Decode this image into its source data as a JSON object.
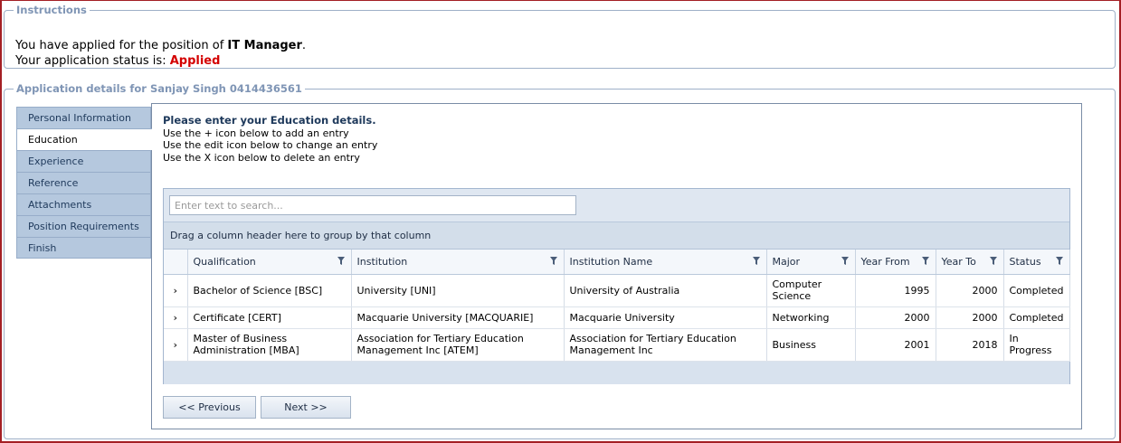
{
  "instructions": {
    "legend": "Instructions",
    "line1_prefix": "You have applied for the position of ",
    "position": "IT Manager",
    "line1_suffix": ".",
    "line2_prefix": "Your application status is: ",
    "status": "Applied"
  },
  "application": {
    "legend": "Application details for Sanjay Singh 0414436561"
  },
  "tabs": [
    {
      "label": "Personal Information",
      "active": false
    },
    {
      "label": "Education",
      "active": true
    },
    {
      "label": "Experience",
      "active": false
    },
    {
      "label": "Reference",
      "active": false
    },
    {
      "label": "Attachments",
      "active": false
    },
    {
      "label": "Position Requirements",
      "active": false
    },
    {
      "label": "Finish",
      "active": false
    }
  ],
  "education": {
    "title": "Please enter your Education details.",
    "hint_add": "Use the + icon below to add an entry",
    "hint_edit": "Use the edit icon below to change an entry",
    "hint_delete": "Use the X icon below to delete an entry"
  },
  "grid": {
    "search_placeholder": "Enter text to search...",
    "group_panel": "Drag a column header here to group by that column",
    "columns": [
      "Qualification",
      "Institution",
      "Institution Name",
      "Major",
      "Year From",
      "Year To",
      "Status"
    ],
    "rows": [
      {
        "qualification": "Bachelor of Science [BSC]",
        "institution": "University [UNI]",
        "institution_name": "University of Australia",
        "major": "Computer Science",
        "year_from": "1995",
        "year_to": "2000",
        "status": "Completed"
      },
      {
        "qualification": "Certificate [CERT]",
        "institution": "Macquarie University [MACQUARIE]",
        "institution_name": "Macquarie University",
        "major": "Networking",
        "year_from": "2000",
        "year_to": "2000",
        "status": "Completed"
      },
      {
        "qualification": "Master of Business Administration [MBA]",
        "institution": "Association for Tertiary Education Management Inc [ATEM]",
        "institution_name": "Association for Tertiary Education Management Inc",
        "major": "Business",
        "year_from": "2001",
        "year_to": "2018",
        "status": "In Progress"
      }
    ],
    "expand_glyph": "›",
    "filter_icon": "funnel-icon"
  },
  "buttons": {
    "previous": "<< Previous",
    "next": "Next >>"
  },
  "colors": {
    "status_applied": "#d40000",
    "legend_text": "#7f95b5",
    "tab_bg": "#b5c8de",
    "frame_border": "#a41f24"
  }
}
